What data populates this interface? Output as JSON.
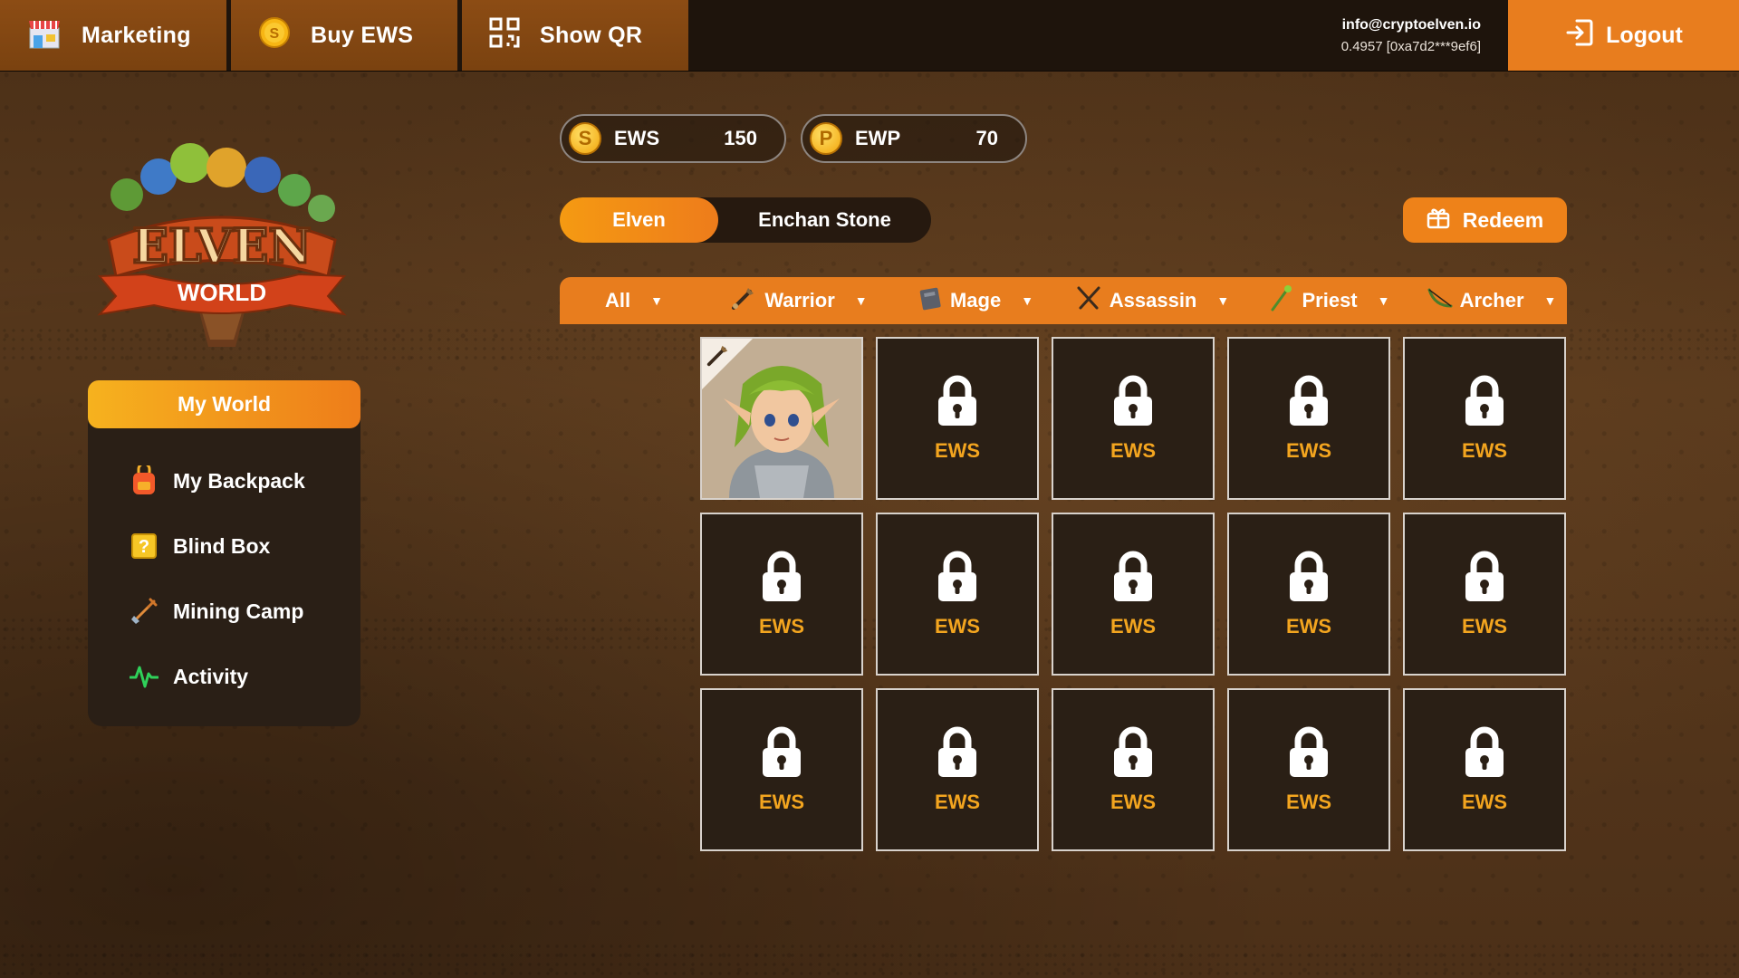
{
  "topbar": {
    "marketing_label": "Marketing",
    "buy_label": "Buy EWS",
    "qr_label": "Show QR",
    "email": "info@cryptoelven.io",
    "wallet": "0.4957 [0xa7d2***9ef6]",
    "logout_label": "Logout"
  },
  "logo": {
    "text_top": "ELVEN",
    "text_bottom": "WORLD"
  },
  "sidebar": {
    "header": "My World",
    "items": [
      {
        "label": "My Backpack",
        "icon": "backpack-icon"
      },
      {
        "label": "Blind Box",
        "icon": "question-box-icon"
      },
      {
        "label": "Mining Camp",
        "icon": "shovel-icon"
      },
      {
        "label": "Activity",
        "icon": "activity-icon"
      }
    ]
  },
  "balances": [
    {
      "symbol": "S",
      "name": "EWS",
      "amount": "150"
    },
    {
      "symbol": "P",
      "name": "EWP",
      "amount": "70"
    }
  ],
  "tabs": [
    {
      "label": "Elven",
      "active": true
    },
    {
      "label": "Enchan Stone",
      "active": false
    }
  ],
  "redeem_label": "Redeem",
  "filters": [
    {
      "label": "All",
      "icon": null
    },
    {
      "label": "Warrior",
      "icon": "sword-icon"
    },
    {
      "label": "Mage",
      "icon": "spellbook-icon"
    },
    {
      "label": "Assassin",
      "icon": "daggers-icon"
    },
    {
      "label": "Priest",
      "icon": "staff-icon"
    },
    {
      "label": "Archer",
      "icon": "bow-icon"
    }
  ],
  "grid": {
    "locked_label": "EWS",
    "hero": {
      "class_icon": "sword-icon",
      "name": "elf-warrior"
    }
  },
  "colors": {
    "accent": "#e87d1e",
    "gold": "#f3a51f",
    "panel": "#2a1f16",
    "topbar": "#1e140c"
  }
}
